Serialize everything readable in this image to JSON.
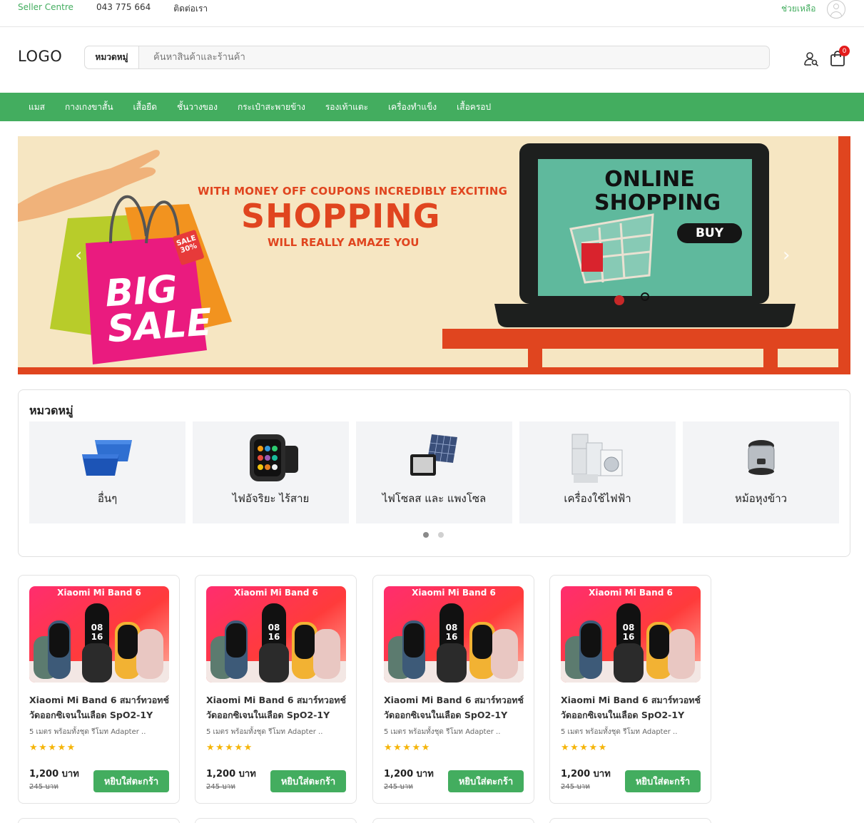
{
  "topbar": {
    "seller": "Seller Centre",
    "phone": "043 775 664",
    "contact": "ติดต่อเรา",
    "help": "ช่วยเหลือ"
  },
  "header": {
    "logo": "LOGO",
    "search_category": "หมวดหมู่",
    "search_placeholder": "ค้นหาสินค้าและร้านค้า",
    "cart_count": "0"
  },
  "nav": {
    "items": [
      "แมส",
      "กางเกงขาสั้น",
      "เสื้อยืด",
      "ชั้นวางของ",
      "กระเป๋าสะพายข้าง",
      "รองเท้าแตะ",
      "เครื่องทำแข็ง",
      "เสื้อครอป"
    ]
  },
  "banner": {
    "line1": "WITH MONEY OFF COUPONS INCREDIBLY EXCITING",
    "line2": "SHOPPING",
    "line3": "WILL REALLY AMAZE YOU",
    "big_sale": "BIG SALE",
    "sale_tag": "SALE 30%",
    "online_shopping": "ONLINE SHOPPING",
    "buy": "BUY",
    "prev": "‹",
    "next": "›"
  },
  "categories": {
    "title": "หมวดหมู่",
    "items": [
      {
        "label": "อื่นๆ",
        "icon": "plastic-tub-icon"
      },
      {
        "label": "ไฟอัจริยะ ไร้สาย",
        "icon": "smartwatch-icon"
      },
      {
        "label": "ไฟโซลส และ แพงโซล",
        "icon": "solar-light-icon"
      },
      {
        "label": "เครื่องใช้ไฟฟ้า",
        "icon": "appliances-icon"
      },
      {
        "label": "หม้อหุงข้าว",
        "icon": "rice-cooker-icon"
      }
    ]
  },
  "products": [
    {
      "thumb_title": "Xiaomi Mi Band 6",
      "name": "Xiaomi Mi Band 6 สมาร์ทวอทช์ วัดออกซิเจนในเลือด SpO2-1Y",
      "desc": "5 เมตร พร้อมทั้งชุด รีโมท Adapter ..",
      "stars": "★★★★★",
      "price": "1,200 บาท",
      "old_price": "245 บาท",
      "button": "หยิบใส่ตะกร้า"
    },
    {
      "thumb_title": "Xiaomi Mi Band 6",
      "name": "Xiaomi Mi Band 6 สมาร์ทวอทช์ วัดออกซิเจนในเลือด SpO2-1Y",
      "desc": "5 เมตร พร้อมทั้งชุด รีโมท Adapter ..",
      "stars": "★★★★★",
      "price": "1,200 บาท",
      "old_price": "245 บาท",
      "button": "หยิบใส่ตะกร้า"
    },
    {
      "thumb_title": "Xiaomi Mi Band 6",
      "name": "Xiaomi Mi Band 6 สมาร์ทวอทช์ วัดออกซิเจนในเลือด SpO2-1Y",
      "desc": "5 เมตร พร้อมทั้งชุด รีโมท Adapter ..",
      "stars": "★★★★★",
      "price": "1,200 บาท",
      "old_price": "245 บาท",
      "button": "หยิบใส่ตะกร้า"
    },
    {
      "thumb_title": "Xiaomi Mi Band 6",
      "name": "Xiaomi Mi Band 6 สมาร์ทวอทช์ วัดออกซิเจนในเลือด SpO2-1Y",
      "desc": "5 เมตร พร้อมทั้งชุด รีโมท Adapter ..",
      "stars": "★★★★★",
      "price": "1,200 บาท",
      "old_price": "245 บาท",
      "button": "หยิบใส่ตะกร้า"
    }
  ],
  "colors": {
    "brand_green": "#43ad5f",
    "banner_red": "#e0451f",
    "badge_red": "#e31c1c",
    "star_yellow": "#f5b50a"
  }
}
